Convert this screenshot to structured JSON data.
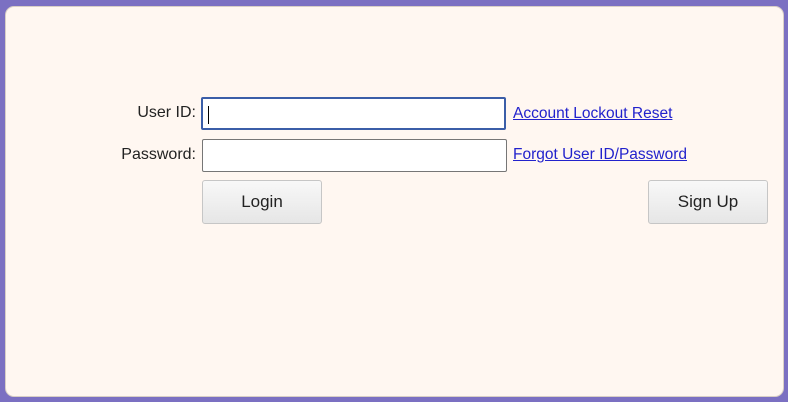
{
  "login_form": {
    "user_id_label": "User ID:",
    "user_id_value": "",
    "password_label": "Password:",
    "password_value": "",
    "account_lockout_link": "Account Lockout Reset",
    "forgot_link": "Forgot User ID/Password",
    "login_button": "Login",
    "signup_button": "Sign Up"
  },
  "colors": {
    "frame": "#7b70c2",
    "panel_background": "#fff7f1",
    "link": "#2222cc",
    "focused_border": "#3b5ea8"
  }
}
